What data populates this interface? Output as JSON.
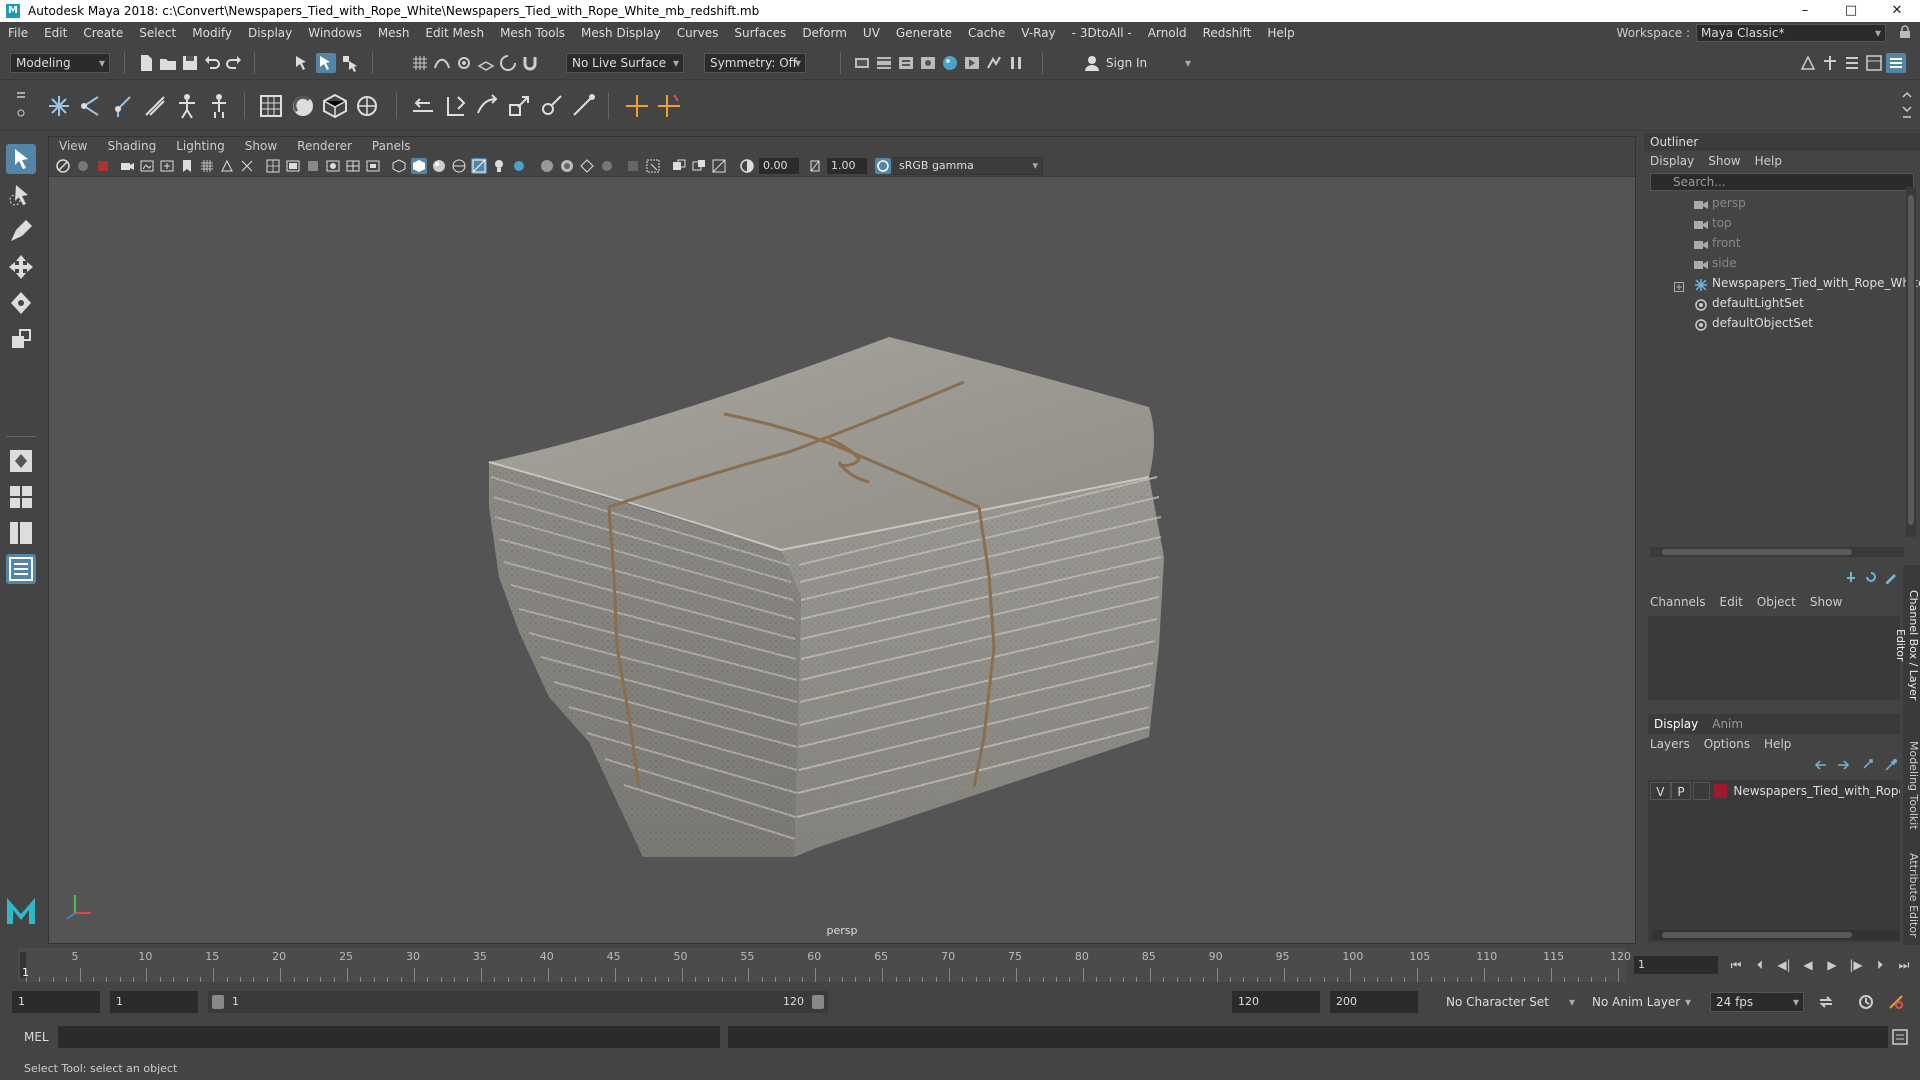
{
  "window": {
    "title": "Autodesk Maya 2018: c:\\Convert\\Newspapers_Tied_with_Rope_White\\Newspapers_Tied_with_Rope_White_mb_redshift.mb",
    "minimize": "–",
    "maximize": "□",
    "close": "✕"
  },
  "menus": [
    "File",
    "Edit",
    "Create",
    "Select",
    "Modify",
    "Display",
    "Windows",
    "Mesh",
    "Edit Mesh",
    "Mesh Tools",
    "Mesh Display",
    "Curves",
    "Surfaces",
    "Deform",
    "UV",
    "Generate",
    "Cache",
    "V-Ray",
    "- 3DtoAll -",
    "Arnold",
    "Redshift",
    "Help"
  ],
  "workspace": {
    "label": "Workspace :",
    "value": "Maya Classic*"
  },
  "status_line": {
    "mode": "Modeling",
    "live_surface": "No Live Surface",
    "symmetry": "Symmetry: Off",
    "sign_in": "Sign In"
  },
  "viewport": {
    "menus": [
      "View",
      "Shading",
      "Lighting",
      "Show",
      "Renderer",
      "Panels"
    ],
    "exposure": "0.00",
    "gamma": "1.00",
    "color_space": "sRGB gamma",
    "camera": "persp"
  },
  "outliner": {
    "title": "Outliner",
    "menus": [
      "Display",
      "Show",
      "Help"
    ],
    "search_placeholder": "Search...",
    "items": [
      {
        "label": "persp",
        "kind": "camera"
      },
      {
        "label": "top",
        "kind": "camera"
      },
      {
        "label": "front",
        "kind": "camera"
      },
      {
        "label": "side",
        "kind": "camera"
      },
      {
        "label": "Newspapers_Tied_with_Rope_White_ncl",
        "kind": "group"
      },
      {
        "label": "defaultLightSet",
        "kind": "set"
      },
      {
        "label": "defaultObjectSet",
        "kind": "set"
      }
    ]
  },
  "channel_box": {
    "menus": [
      "Channels",
      "Edit",
      "Object",
      "Show"
    ],
    "tabs": [
      "Display",
      "Anim"
    ],
    "layer_menus": [
      "Layers",
      "Options",
      "Help"
    ],
    "layer": {
      "v": "V",
      "p": "P",
      "name": "Newspapers_Tied_with_Rope_",
      "color": "#9c1b2e"
    }
  },
  "side_tabs": [
    "Channel Box / Layer Editor",
    "Modeling Toolkit",
    "Attribute Editor"
  ],
  "timeline": {
    "ticks": [
      "5",
      "10",
      "15",
      "20",
      "25",
      "30",
      "35",
      "40",
      "45",
      "50",
      "55",
      "60",
      "65",
      "70",
      "75",
      "80",
      "85",
      "90",
      "95",
      "100",
      "105",
      "110",
      "115",
      "120"
    ],
    "start_label": "1",
    "current_frame": "1"
  },
  "range": {
    "start": "1",
    "anim_start": "1",
    "slider_start": "1",
    "slider_end": "120",
    "end": "120",
    "anim_end": "200",
    "character_set": "No Character Set",
    "anim_layer": "No Anim Layer",
    "fps": "24 fps"
  },
  "command_line": {
    "label": "MEL"
  },
  "help_line": "Select Tool: select an object",
  "colors": {
    "accent": "#5285a6",
    "background": "#444444",
    "viewport": "#545454"
  }
}
